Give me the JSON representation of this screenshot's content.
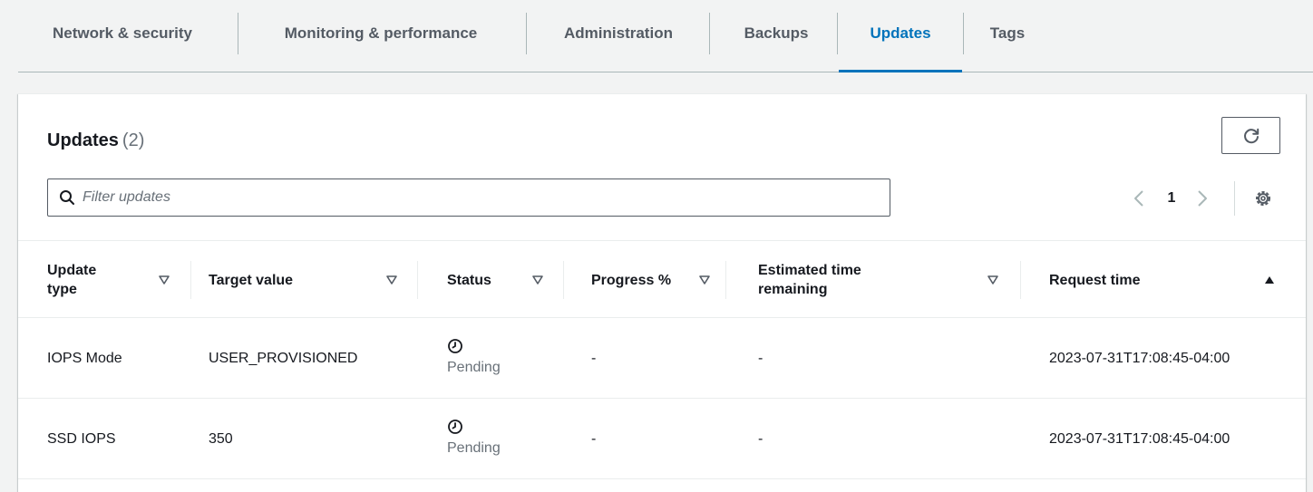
{
  "tabs": [
    {
      "label": "Network & security"
    },
    {
      "label": "Monitoring & performance"
    },
    {
      "label": "Administration"
    },
    {
      "label": "Backups"
    },
    {
      "label": "Updates"
    },
    {
      "label": "Tags"
    }
  ],
  "active_tab": "Updates",
  "panel": {
    "title": "Updates",
    "count": "(2)"
  },
  "refresh_icon": "refresh-icon",
  "filter": {
    "placeholder": "Filter updates",
    "value": ""
  },
  "pagination": {
    "current_page": "1"
  },
  "table": {
    "columns": [
      {
        "label": "Update type",
        "sort": "none"
      },
      {
        "label": "Target value",
        "sort": "none"
      },
      {
        "label": "Status",
        "sort": "none"
      },
      {
        "label": "Progress %",
        "sort": "none"
      },
      {
        "label": "Estimated time remaining",
        "sort": "none"
      },
      {
        "label": "Request time",
        "sort": "ascending"
      }
    ],
    "rows": [
      {
        "update_type": "IOPS Mode",
        "target_value": "USER_PROVISIONED",
        "status": "Pending",
        "status_icon": "clock-icon",
        "progress": "-",
        "eta": "-",
        "request_time": "2023-07-31T17:08:45-04:00"
      },
      {
        "update_type": "SSD IOPS",
        "target_value": "350",
        "status": "Pending",
        "status_icon": "clock-icon",
        "progress": "-",
        "eta": "-",
        "request_time": "2023-07-31T17:08:45-04:00"
      }
    ]
  },
  "colors": {
    "accent": "#0073bb",
    "text": "#16191f",
    "muted": "#687078",
    "border": "#eaeded"
  }
}
